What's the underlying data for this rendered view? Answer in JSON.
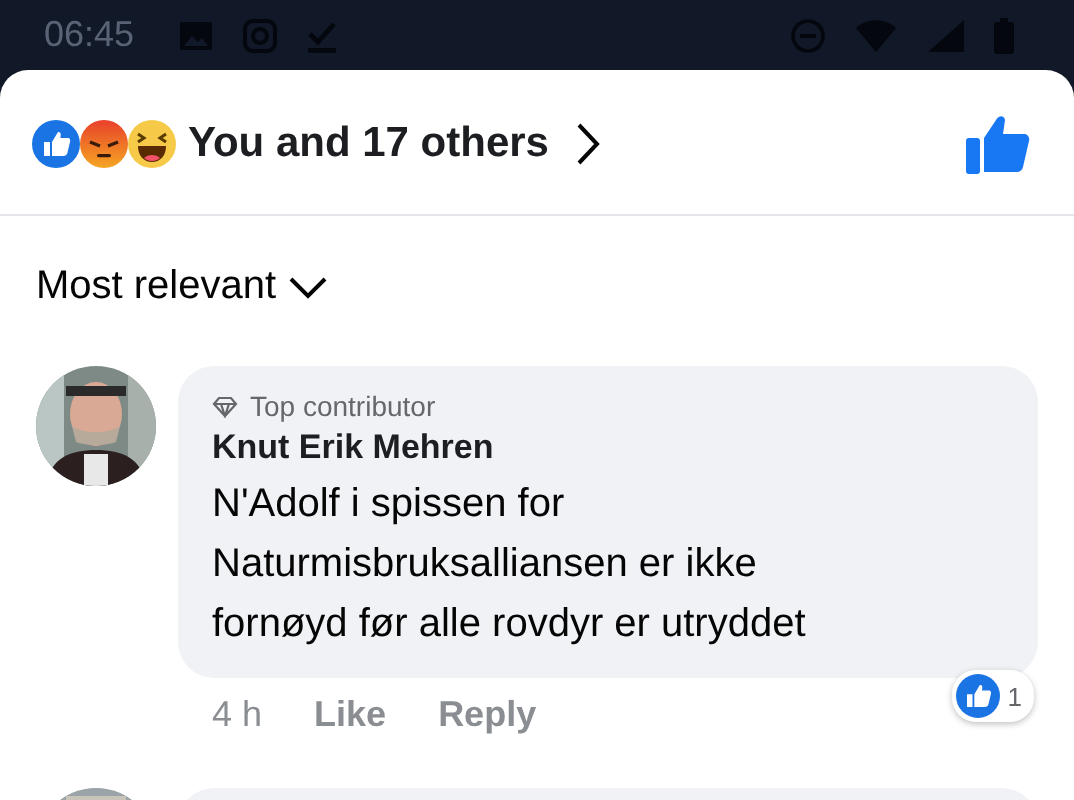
{
  "status_bar": {
    "time": "06:45"
  },
  "reactions": {
    "summary": "You and 17 others",
    "liked": true
  },
  "sort": {
    "label": "Most relevant"
  },
  "comments": [
    {
      "badge": "Top contributor",
      "author": "Knut Erik Mehren",
      "text": "N'Adolf i spissen for Naturmisbruksalliansen er ikke fornøyd før alle rovdyr er utryddet",
      "time": "4 h",
      "actions": [
        "Like",
        "Reply"
      ],
      "reaction_count": "1"
    }
  ]
}
